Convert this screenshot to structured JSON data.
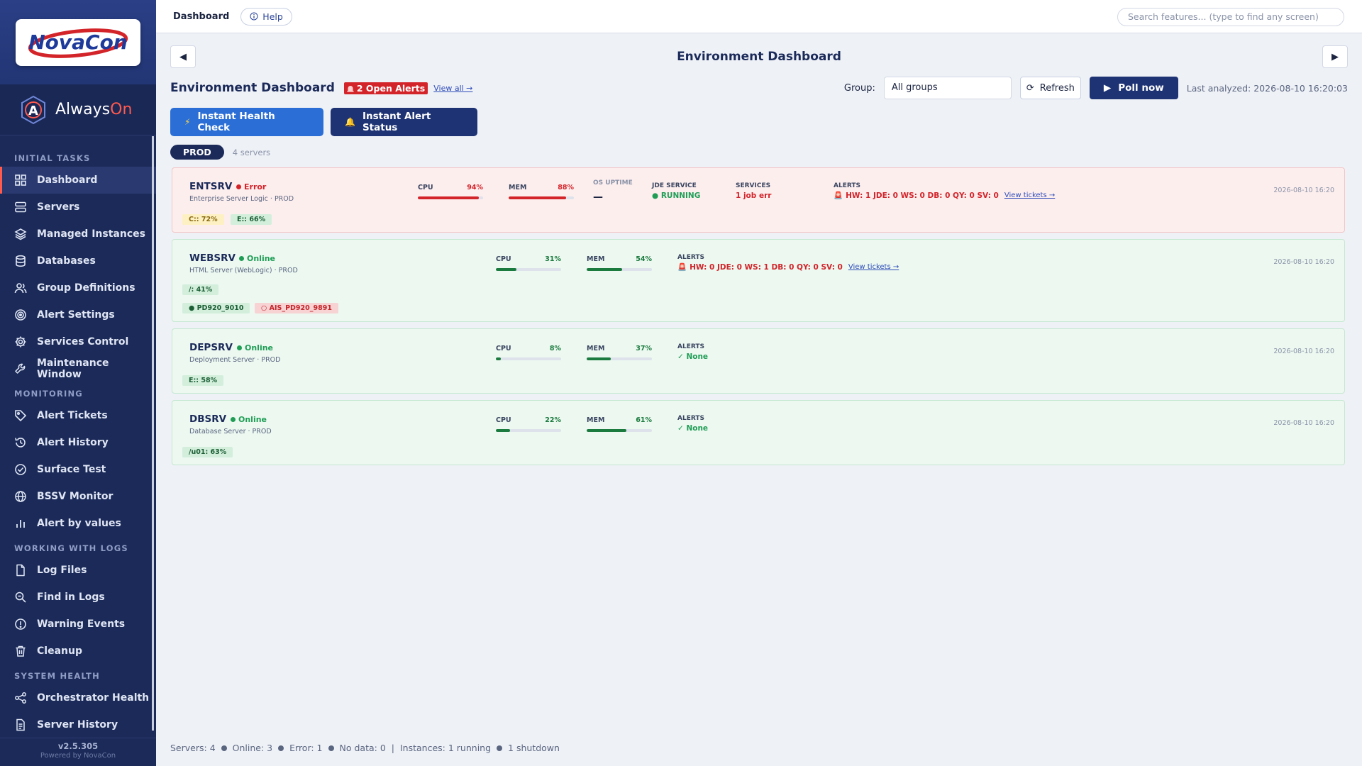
{
  "sidebar": {
    "logo_text": "NovaCon",
    "brand_prefix": "Always",
    "brand_suffix": "On",
    "sections": [
      {
        "title": "INITIAL TASKS",
        "items": [
          "Dashboard",
          "Servers",
          "Managed Instances",
          "Databases",
          "Group Definitions",
          "Alert Settings",
          "Services Control",
          "Maintenance Window"
        ]
      },
      {
        "title": "MONITORING",
        "items": [
          "Alert Tickets",
          "Alert History",
          "Surface Test",
          "BSSV Monitor",
          "Alert by values"
        ]
      },
      {
        "title": "WORKING WITH LOGS",
        "items": [
          "Log Files",
          "Find in Logs",
          "Warning Events",
          "Cleanup"
        ]
      },
      {
        "title": "SYSTEM HEALTH",
        "items": [
          "Orchestrator Health",
          "Server History"
        ]
      }
    ],
    "active_item": "Dashboard",
    "icons": [
      "grid-icon",
      "server-icon",
      "layers-icon",
      "database-icon",
      "users-icon",
      "target-icon",
      "gear-icon",
      "wrench-icon",
      "tag-icon",
      "history-icon",
      "check-circle-icon",
      "globe-icon",
      "bar-chart-icon",
      "file-icon",
      "search-file-icon",
      "warning-icon",
      "trash-icon",
      "share-icon",
      "document-icon"
    ],
    "version": "v2.5.305",
    "powered_by": "Powered by NovaCon"
  },
  "topbar": {
    "breadcrumb": "Dashboard",
    "help_label": "Help",
    "search_placeholder": "Search features...  (type to find any screen)"
  },
  "main": {
    "page_heading": "Environment Dashboard",
    "env_title": "Environment Dashboard",
    "open_alerts": "2 Open Alerts",
    "view_all": "View all →",
    "group_label": "Group:",
    "group_value": "All groups",
    "refresh_label": "Refresh",
    "poll_label": "Poll now",
    "last_analyzed": "Last analyzed: 2026-08-10 16:20:03",
    "health_check_label": "Instant Health Check",
    "alert_status_label": "Instant Alert Status",
    "env_name": "PROD",
    "env_count": "4 servers",
    "summary": {
      "servers": "Servers: 4",
      "online": "Online: 3",
      "error": "Error: 1",
      "nodata": "No data: 0",
      "sep": "|",
      "instances": "Instances: 1 running",
      "shutdown": "1 shutdown"
    }
  },
  "servers": [
    {
      "name": "ENTSRV",
      "status": "Error",
      "subtitle": "Enterprise Server Logic  ·  PROD",
      "cpu_label": "CPU",
      "cpu": "94%",
      "cpu_value": 94,
      "mem_label": "MEM",
      "mem": "88%",
      "mem_value": 88,
      "uptime_label": "OS UPTIME",
      "uptime": "—",
      "jde_label": "JDE SERVICE",
      "jde": "RUNNING",
      "services_label": "SERVICES",
      "services": "1 job err",
      "alerts_label": "ALERTS",
      "alerts": "HW: 1 JDE: 0 WS: 0 DB: 0 QY: 0 SV: 0",
      "tickets": "View tickets →",
      "timestamp": "2026-08-10 16:20",
      "chips": [
        "C:: 72%",
        "E:: 66%"
      ]
    },
    {
      "name": "WEBSRV",
      "status": "Online",
      "subtitle": "HTML Server (WebLogic)  ·  PROD",
      "cpu_label": "CPU",
      "cpu": "31%",
      "cpu_value": 31,
      "mem_label": "MEM",
      "mem": "54%",
      "mem_value": 54,
      "alerts_label": "ALERTS",
      "alerts": "HW: 0 JDE: 0 WS: 1 DB: 0 QY: 0 SV: 0",
      "tickets": "View tickets →",
      "timestamp": "2026-08-10 16:20",
      "chips": [
        "/: 41%"
      ],
      "instances": [
        "● PD920_9010",
        "○ AIS_PD920_9891"
      ]
    },
    {
      "name": "DEPSRV",
      "status": "Online",
      "subtitle": "Deployment Server  ·  PROD",
      "cpu_label": "CPU",
      "cpu": "8%",
      "cpu_value": 8,
      "mem_label": "MEM",
      "mem": "37%",
      "mem_value": 37,
      "alerts_label": "ALERTS",
      "alerts": "✓ None",
      "timestamp": "2026-08-10 16:20",
      "chips": [
        "E:: 58%"
      ]
    },
    {
      "name": "DBSRV",
      "status": "Online",
      "subtitle": "Database Server  ·  PROD",
      "cpu_label": "CPU",
      "cpu": "22%",
      "cpu_value": 22,
      "mem_label": "MEM",
      "mem": "61%",
      "mem_value": 61,
      "alerts_label": "ALERTS",
      "alerts": "✓ None",
      "timestamp": "2026-08-10 16:20",
      "chips": [
        "/u01: 63%"
      ]
    }
  ]
}
